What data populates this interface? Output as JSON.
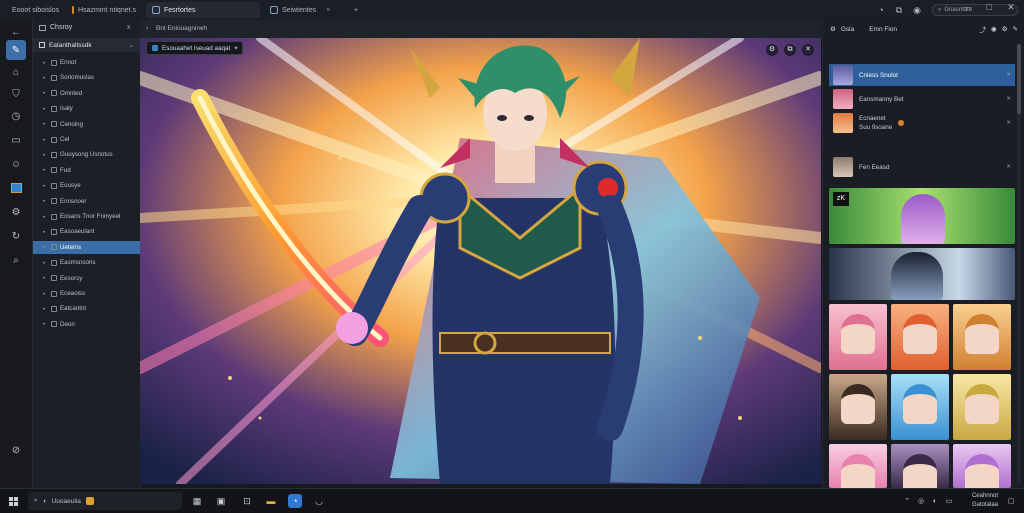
{
  "colors": {
    "accent": "#3a6ea6",
    "selection": "#2d5f9a",
    "background": "#16191f"
  },
  "titlebar": {
    "tabs": [
      {
        "label": "Eooot siboislos",
        "icon": "app-icon",
        "active": false
      },
      {
        "label": "Hsazmmt ntiqnet.s",
        "icon": "folder-icon",
        "active": false
      },
      {
        "label": "Fesrtortes",
        "icon": "image-icon",
        "active": true
      },
      {
        "label": "Seiwtentes",
        "icon": "image-icon",
        "active": false
      }
    ],
    "new_tab": "+",
    "close_tab": "×",
    "search_placeholder": "Gnasmate",
    "window_controls": [
      "—",
      "□",
      "✕"
    ]
  },
  "rail": {
    "icons": [
      "back-icon",
      "pen-icon",
      "home-icon",
      "shield-icon",
      "clock-icon",
      "chat-icon",
      "smile-icon",
      "gallery-icon",
      "settings-icon",
      "sync-icon",
      "search-icon",
      "help-icon"
    ]
  },
  "sidebar": {
    "top_label": "Chsroy",
    "header": "Eatanthaltssdk",
    "items": [
      {
        "label": "Ennot",
        "selected": false
      },
      {
        "label": "Soriomuslas",
        "selected": false
      },
      {
        "label": "Omnted",
        "selected": false
      },
      {
        "label": "Isaly",
        "selected": false
      },
      {
        "label": "Cenoing",
        "selected": false
      },
      {
        "label": "Cel",
        "selected": false
      },
      {
        "label": "Guuysong Usnotus",
        "selected": false
      },
      {
        "label": "Fud",
        "selected": false
      },
      {
        "label": "Eousye",
        "selected": false
      },
      {
        "label": "Ennsnoer",
        "selected": false
      },
      {
        "label": "Eosans Tnor Fnmyeel",
        "selected": false
      },
      {
        "label": "Easoaeulant",
        "selected": false
      },
      {
        "label": "Ueteins",
        "selected": true
      },
      {
        "label": "Easmsnsons",
        "selected": false
      },
      {
        "label": "Eesorsy",
        "selected": false
      },
      {
        "label": "Eceaoiss",
        "selected": false
      },
      {
        "label": "Eatcantnt",
        "selected": false
      },
      {
        "label": "Deon",
        "selected": false
      }
    ]
  },
  "viewer": {
    "path_label": "Esouaahet Iseuad aaqat",
    "path_secondary": "Bnt Enlouagnirwh",
    "overlay_buttons": [
      "gear",
      "copy",
      "close"
    ]
  },
  "rpanel": {
    "head_label": "Gsla",
    "head_secondary": "Emn Fion",
    "messages": [
      {
        "name": "Cniess Snulot",
        "meta": "✕",
        "selected": true
      },
      {
        "name": "Eansmanny Bet",
        "meta": "✕",
        "selected": false
      },
      {
        "name": "Ecnaenet",
        "name2": "Suu fisoane",
        "meta": "✕",
        "selected": false
      },
      {
        "name": "Fen Eeasd",
        "meta": "✕",
        "selected": false
      }
    ],
    "gallery_label": "zK"
  },
  "taskbar": {
    "search_text": "Uuoaeulia",
    "tray_time": "Ceahnnot",
    "tray_date": "Gatotalaa"
  }
}
